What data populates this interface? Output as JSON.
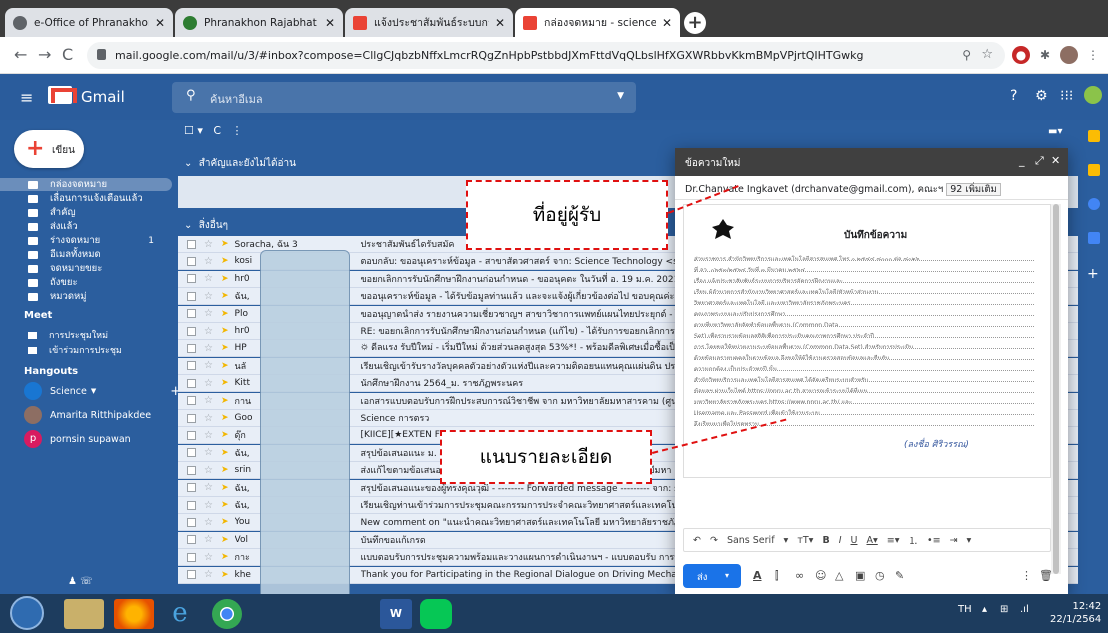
{
  "browser": {
    "tabs": [
      {
        "label": "e-Office of Phranakhon Rajabhat",
        "icon": "eoffice-icon",
        "color": "#5f6368"
      },
      {
        "label": "Phranakhon Rajabhat University",
        "icon": "university-icon",
        "color": "#2e7d32"
      },
      {
        "label": "แจ้งประชาสัมพันธ์ระบบการการฝึกงานให",
        "icon": "gmail-icon",
        "color": "#ea4335"
      },
      {
        "label": "กล่องจดหมาย - science.techno11",
        "icon": "gmail-icon",
        "color": "#ea4335"
      }
    ],
    "url": "mail.google.com/mail/u/3/#inbox?compose=CllgCJqbzbNffxLmcrRQgZnHpbPstbbdJXmFttdVqQLbslHfXGXWRbbvKkmBMpVPjrtQIHTGwkg"
  },
  "gmail": {
    "app_name": "Gmail",
    "search_placeholder": "ค้นหาอีเมล",
    "compose_label": "เขียน",
    "sidebar": {
      "items": [
        {
          "label": "กล่องจดหมาย",
          "count": ""
        },
        {
          "label": "เลื่อนการแจ้งเตือนแล้ว",
          "count": ""
        },
        {
          "label": "สำคัญ",
          "count": ""
        },
        {
          "label": "ส่งแล้ว",
          "count": ""
        },
        {
          "label": "ร่างจดหมาย",
          "count": "1"
        },
        {
          "label": "อีเมลทั้งหมด",
          "count": ""
        },
        {
          "label": "จดหมายขยะ",
          "count": ""
        },
        {
          "label": "ถังขยะ",
          "count": ""
        },
        {
          "label": "หมวดหมู่",
          "count": ""
        }
      ],
      "meet_title": "Meet",
      "meet_items": [
        "การประชุมใหม่",
        "เข้าร่วมการประชุม"
      ],
      "hangouts_title": "Hangouts",
      "hangouts_self": "Science",
      "contacts": [
        {
          "name": "Amarita Ritthipakdee",
          "initial": "",
          "color": "#8d6e63"
        },
        {
          "name": "pornsin supawan",
          "initial": "p",
          "color": "#d81b60"
        }
      ]
    },
    "section_important": "สำคัญและยังไม่ได้อ่าน",
    "section_other": "สิ่งอื่นๆ",
    "rows": [
      {
        "sender": "Soracha, ฉัน 3",
        "subject": "ประชาสัมพันธ์ไดรับสมัค"
      },
      {
        "sender": "kosi",
        "subject": "ตอบกลับ: ขออนุเคราะห์ข้อมูล - สาขาสัตวศาสตร์ จาก: Science Technology <sci"
      },
      {
        "sender": "hr0",
        "subject": "ขอยกเลิกการรับนักศึกษาฝึกงานก่อนกำหนด - ขออนุคตะ ในวันที่ อ. 19 ม.ค. 2021"
      },
      {
        "sender": "ฉัน,",
        "subject": "ขออนุเคราะห์ข้อมูล - ได้รับข้อมูลท่านแล้ว และจะแจ้งผู้เกี่ยวข้องต่อไป ขอบคุณค่ะ"
      },
      {
        "sender": "Plo",
        "subject": "ขออนุญาตนำส่ง รายงานความเชี่ยวชาญฯ สาขาวิชาการแพทย์แผนไทยประยุกต์ - ไ"
      },
      {
        "sender": "hr0",
        "subject": "RE: ขอยกเลิกการรับนักศึกษาฝึกงานก่อนกำหนด (แก้ไข) - ได้รับการขอยกเลิกการรั"
      },
      {
        "sender": "HP",
        "subject": "🌣 ดีลแรง รับปีใหม่ - เริ่มปีใหม่ ด้วยส่วนลดสูงสุด 53%*! - พร้อมดีลพิเศษเมื่อซื้อเป็น"
      },
      {
        "sender": "นลั",
        "subject": "เรียนเชิญเข้ารับรางวัลบุคคลตัวอย่างตัวแห่งปีและความติดอยนแทนคุณแผ่นดิน ประจำ"
      },
      {
        "sender": "Kitt",
        "subject": "นักศึกษาฝึกงาน 2564_ม. ราชภัฏพระนคร"
      },
      {
        "sender": "กาน",
        "subject": "เอกสารแบบตอบรับการฝึกประสบการณ์วิชาชีพ จาก มหาวิทยาลัยมหาสารคาม (ศูนย"
      },
      {
        "sender": "Goo",
        "subject": "Science การตรว"
      },
      {
        "sender": "ดุ๊ก",
        "subject": "[KIICE][★EXTEN                                            Febr"
      },
      {
        "sender": "ฉัน,",
        "subject": "สรุปข้อเสนอแนะ                                              ม. 4 ม"
      },
      {
        "sender": "srin",
        "subject": "ส่งแก้ไขตามข้อเสนอแนะคณะกรรมการ - ประวัติวิทยาศาสตร์และเทคโนโลยีมหา"
      },
      {
        "sender": "ฉัน,",
        "subject": "สรุปข้อเสนอแนะของผู้ทรงคุณวุฒิ - -------- Forwarded message --------- จาก: sitt"
      },
      {
        "sender": "ฉัน,",
        "subject": "เรียนเชิญท่านเข้าร่วมการประชุมคณะกรรมการประจำคณะวิทยาศาสตร์และเทคโนโล"
      },
      {
        "sender": "You",
        "subject": "New comment on \"แนะนำคณะวิทยาศาสตร์และเทคโนโลยี มหาวิทยาลัยราชภัฏพ"
      },
      {
        "sender": "Vol",
        "subject": "บันทึกขอแก้เกรด"
      },
      {
        "sender": "กาะ",
        "subject": "แบบตอบรับการประชุมความพร้อมและวางแผนการดำเนินงานฯ - แบบตอบรับ การป"
      },
      {
        "sender": "khe",
        "subject": "Thank you for Participating in the Regional Dialogue on Driving Mechanism"
      }
    ]
  },
  "compose": {
    "title": "ข้อความใหม่",
    "recipient": "Dr.Chanvate Ingkavet (drchanvate@gmail.com), คณะฯ",
    "more_label": "92 เพิ่มเติม",
    "memo_title": "บันทึกข้อความ",
    "memo_lines": [
      "ส่วนราชการ   สำนักวิทยบริการและเทคโนโลยีสารสนเทศ โทร.๐ ๒๕๔๔ ๘๐๐๐ ต่อ ๘๐๒๖",
      "ที่  อว. ๐๖๕๓/๒๕๖๔                                   วันที่   ๓ มีนาคม ๒๕๖๔",
      "เรื่อง  แจ้งประชาสัมพันธ์ระบบการบริหารจัดการฝึกงานและ",
      "เรียน  ผู้อำนวยการสำนักงานวิทยาศาสตร์และเทคโนโลยี/หัวหน้าส่วนงาน",
      "       วิทยาศาสตร์และเทคโนโลยี และมหาวิทยาลัยราชภัฏพระนคร",
      "       คุณภาพระบบและปรับปรุงการศึกษา",
      "           ตามที่มหาวิทยาลัยจัดทำข้อมูลพื้นฐาน (Common Data",
      "Set) เพื่อรวบรวมข้อมูลสถิติเพื่อการประเมินคุณภาพการศึกษา ประจำปี",
      "การ โดยขอให้หน่วยงานระบุข้อมูลพื้นฐาน (Common Data Set) สำหรับการประเมิน",
      "ด้วยข้อมูลรายบุคคลในฐานข้อมูล จึงขอให้ผู้ใช้งานตรวจสอบข้อมูลและยืนยัน",
      "ความถูกต้อง เป็นประจำทุกปี นั้น",
      "         สำนักวิทยบริการและเทคโนโลยีสารสนเทศ ได้จัดเตรียมระบบสำหรับ",
      "ข้อมูลฯ ผ่านเว็บไซต์ https://pnru.ac.th  สามารถเข้าระบบได้ที่เมนู",
      "มหาวิทยาลัยราชภัฏพระนคร https://www.pnru.ac.th/  และ",
      "Username และ Password เพื่อเข้าใช้งานระบบ",
      "         จึงเรียนมาเพื่อโปรดทราบ"
    ],
    "signature": "(ลงชื่อ  ศิริวรรณ)",
    "font": "Sans Serif",
    "send_label": "ส่ง"
  },
  "annotations": {
    "recipient_note": "ที่อยู่ผู้รับ",
    "detail_note": "แนบรายละเอียด",
    "color": "#e01010"
  },
  "taskbar": {
    "lang": "TH",
    "time": "12:42",
    "date": "22/1/2564"
  }
}
